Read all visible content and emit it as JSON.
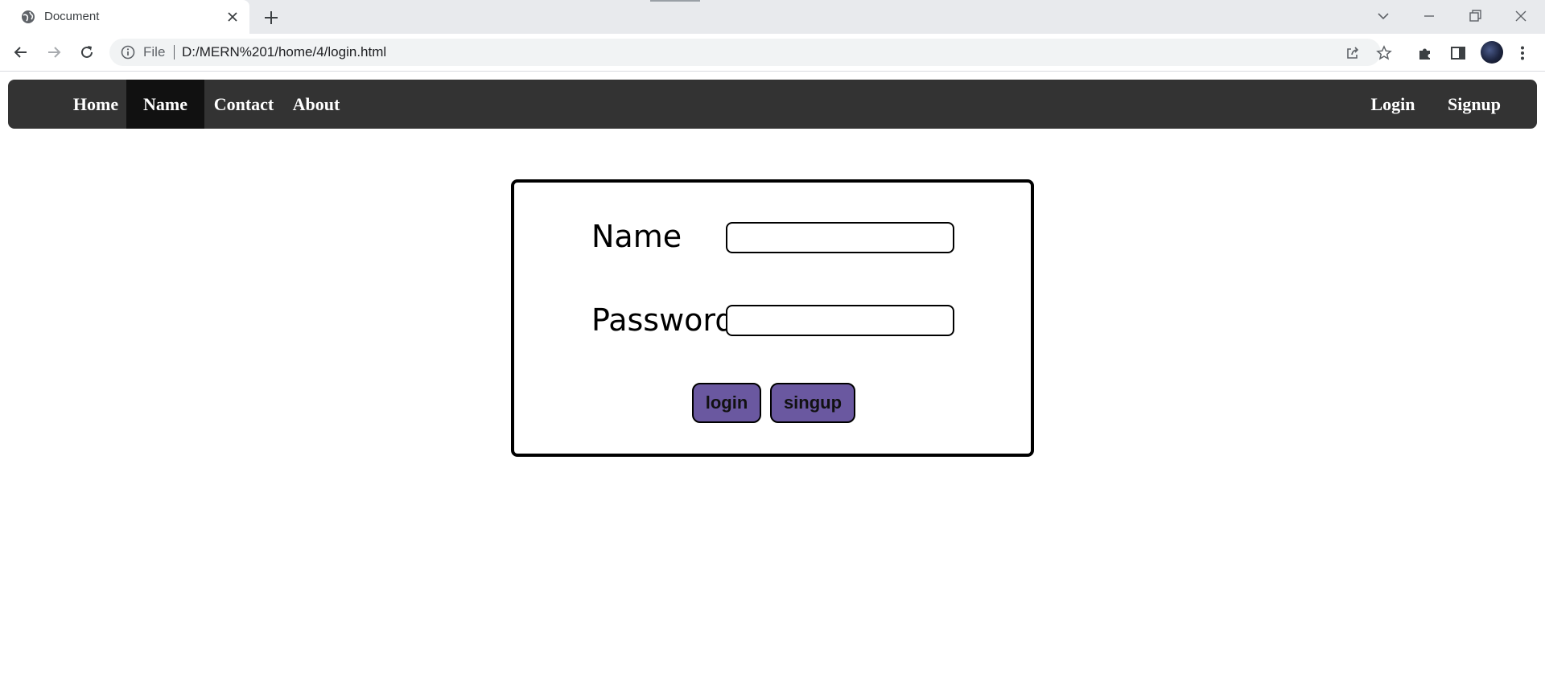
{
  "browser": {
    "tab_title": "Document",
    "omnibox": {
      "scheme_label": "File",
      "url": "D:/MERN%201/home/4/login.html"
    }
  },
  "navbar": {
    "left_links": [
      "Home",
      "Name",
      "Contact",
      "About"
    ],
    "active_link": "Name",
    "right_links": [
      "Login",
      "Signup"
    ],
    "background_color": "#333333",
    "active_background_color": "#111111"
  },
  "form": {
    "name_label": "Name",
    "password_label": "Password",
    "name_value": "",
    "password_value": "",
    "login_button": "login",
    "signup_button": "singup",
    "button_color": "#6a58a0"
  }
}
